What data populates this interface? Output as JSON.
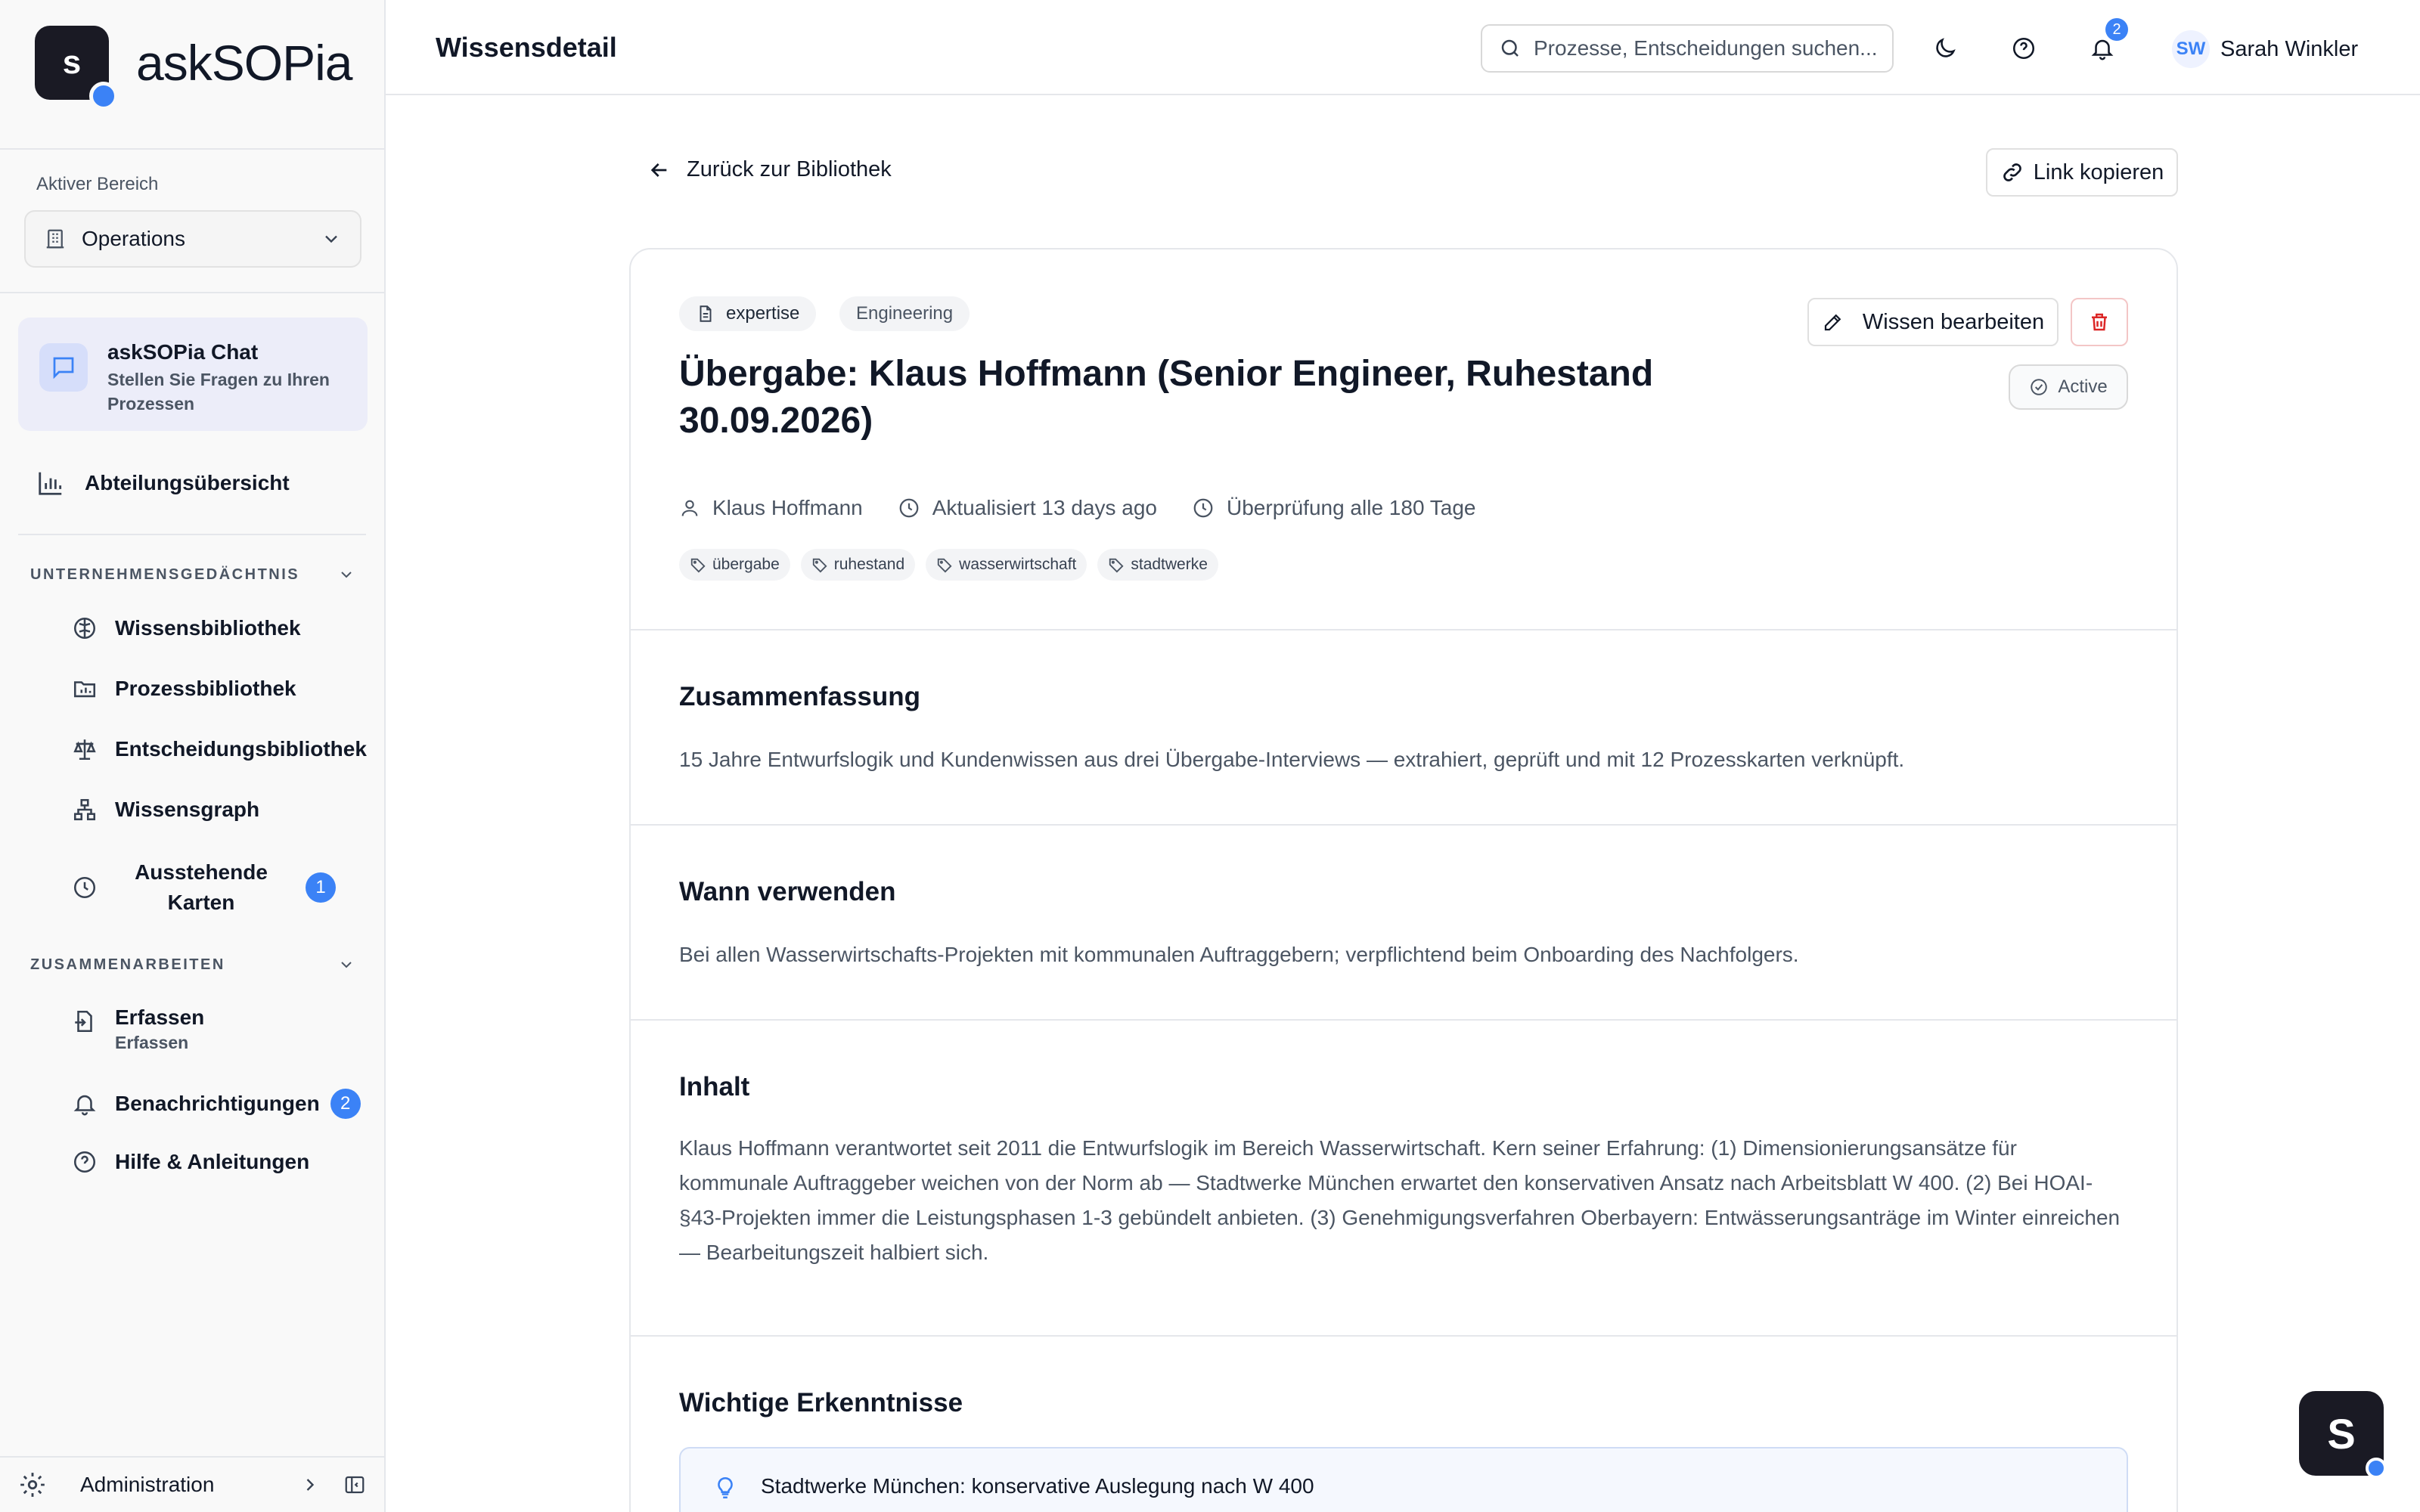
{
  "app": {
    "logo_letter": "s",
    "logo_text": "askSOPia"
  },
  "sidebar": {
    "area_label": "Aktiver Bereich",
    "area_value": "Operations",
    "chat": {
      "title": "askSOPia Chat",
      "subtitle": "Stellen Sie Fragen zu Ihren Prozessen"
    },
    "overview_label": "Abteilungsübersicht",
    "section_memory": "UNTERNEHMENSGEDÄCHTNIS",
    "memory_items": [
      {
        "label": "Wissensbibliothek"
      },
      {
        "label": "Prozessbibliothek"
      },
      {
        "label": "Entscheidungsbibliothek"
      },
      {
        "label": "Wissensgraph"
      },
      {
        "label": "Ausstehende Karten",
        "badge": "1"
      }
    ],
    "section_collab": "ZUSAMMENARBEITEN",
    "collab_items": [
      {
        "label": "Erfassen",
        "sub": "Erfassen"
      },
      {
        "label": "Benachrichtigungen",
        "badge": "2"
      },
      {
        "label": "Hilfe & Anleitungen"
      }
    ],
    "admin_label": "Administration"
  },
  "header": {
    "title": "Wissensdetail",
    "search_placeholder": "Prozesse, Entscheidungen suchen...",
    "notification_count": "2",
    "user_initials": "SW",
    "user_name": "Sarah Winkler"
  },
  "page": {
    "back_label": "Zurück zur Bibliothek",
    "copy_link_label": "Link kopieren",
    "type_chip": "expertise",
    "department_chip": "Engineering",
    "title": "Übergabe: Klaus Hoffmann (Senior Engineer, Ruhestand 30.09.2026)",
    "edit_label": "Wissen bearbeiten",
    "status": "Active",
    "meta": {
      "author": "Klaus Hoffmann",
      "updated": "Aktualisiert 13 days ago",
      "review": "Überprüfung alle 180 Tage"
    },
    "tags": [
      "übergabe",
      "ruhestand",
      "wasserwirtschaft",
      "stadtwerke"
    ],
    "sections": {
      "summary_title": "Zusammenfassung",
      "summary_body": "15 Jahre Entwurfslogik und Kundenwissen aus drei Übergabe-Interviews — extrahiert, geprüft und mit 12 Prozesskarten verknüpft.",
      "when_title": "Wann verwenden",
      "when_body": "Bei allen Wasserwirtschafts-Projekten mit kommunalen Auftraggebern; verpflichtend beim Onboarding des Nachfolgers.",
      "content_title": "Inhalt",
      "content_body": "Klaus Hoffmann verantwortet seit 2011 die Entwurfslogik im Bereich Wasserwirtschaft. Kern seiner Erfahrung: (1) Dimensionierungsansätze für kommunale Auftraggeber weichen von der Norm ab — Stadtwerke München erwartet den konservativen Ansatz nach Arbeitsblatt W 400. (2) Bei HOAI-§43-Projekten immer die Leistungsphasen 1-3 gebündelt anbieten. (3) Genehmigungsverfahren Oberbayern: Entwässerungsanträge im Winter einreichen — Bearbeitungszeit halbiert sich.",
      "insights_title": "Wichtige Erkenntnisse",
      "insight_1": "Stadtwerke München: konservative Auslegung nach W 400"
    }
  },
  "floating": {
    "letter": "S"
  },
  "colors": {
    "accent": "#3b82f6",
    "dark": "#1a1a24",
    "danger": "#dc2626"
  }
}
